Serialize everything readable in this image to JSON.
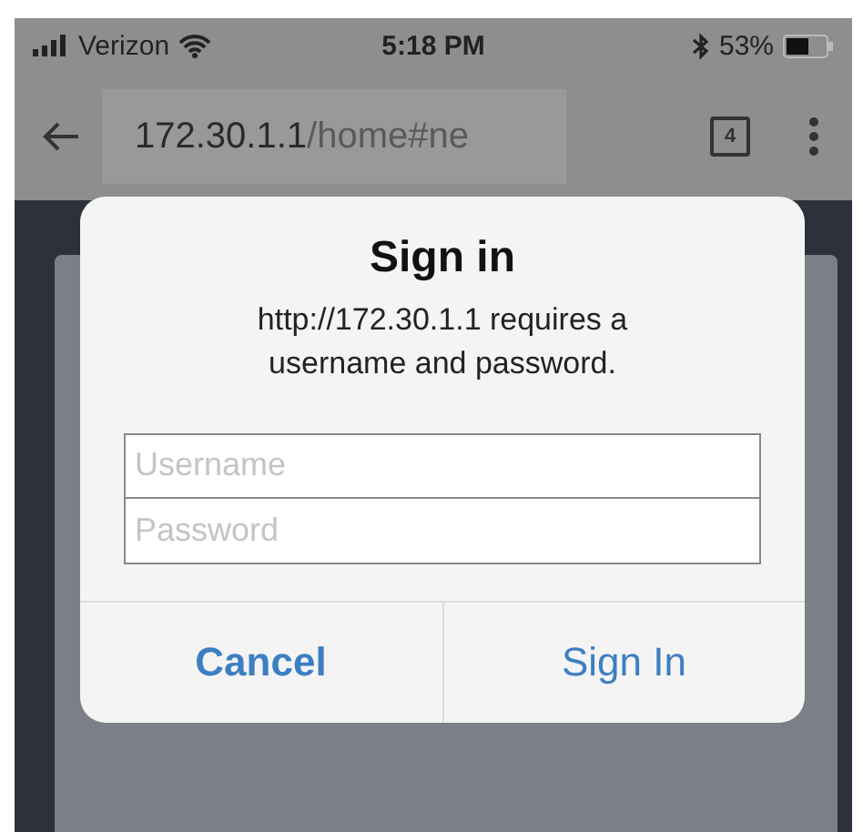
{
  "status_bar": {
    "carrier": "Verizon",
    "time": "5:18 PM",
    "battery": "53%"
  },
  "browser_bar": {
    "url_host": "172.30.1.1",
    "url_path": "/home#ne",
    "tab_count": "4"
  },
  "dialog": {
    "title": "Sign in",
    "message": "http://172.30.1.1 requires a username and password.",
    "fields": [
      {
        "placeholder": "Username"
      },
      {
        "placeholder": "Password"
      }
    ],
    "buttons": [
      {
        "label": "Cancel",
        "kind": "cancel"
      },
      {
        "label": "Sign In",
        "kind": "default"
      }
    ]
  }
}
